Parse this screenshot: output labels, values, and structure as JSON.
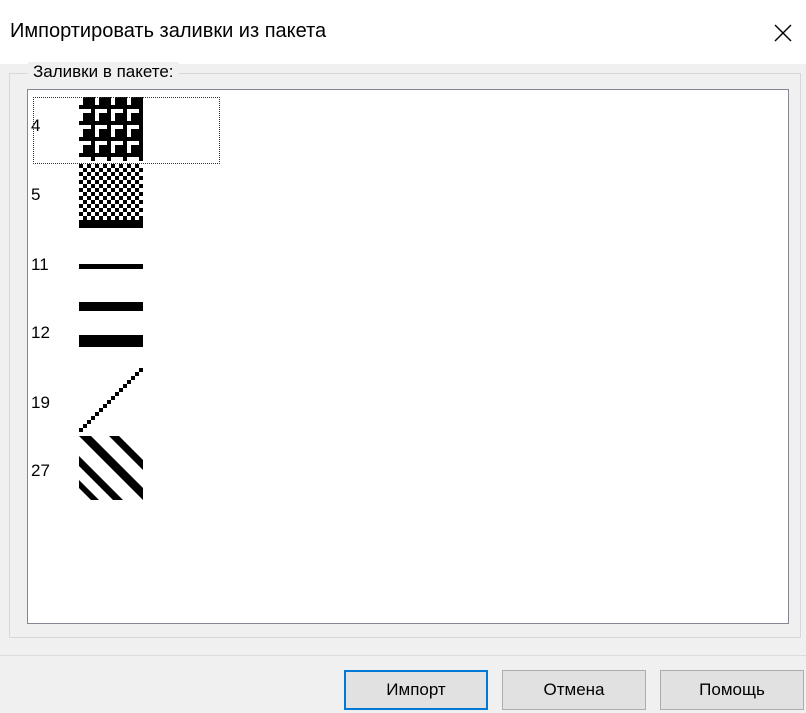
{
  "window": {
    "title": "Импортировать заливки из пакета"
  },
  "group": {
    "label": "Заливки в пакете:"
  },
  "fills": [
    {
      "number": "4",
      "pattern": "grid",
      "selected": true
    },
    {
      "number": "5",
      "pattern": "checker"
    },
    {
      "number": "11",
      "pattern": "thin-line"
    },
    {
      "number": "12",
      "pattern": "thick-lines"
    },
    {
      "number": "19",
      "pattern": "diagonal-forward"
    },
    {
      "number": "27",
      "pattern": "diagonal-backward-bands"
    }
  ],
  "buttons": {
    "import": "Импорт",
    "cancel": "Отмена",
    "help": "Помощь"
  },
  "colors": {
    "default_button_border": "#0078d7",
    "pattern": "#000000"
  }
}
